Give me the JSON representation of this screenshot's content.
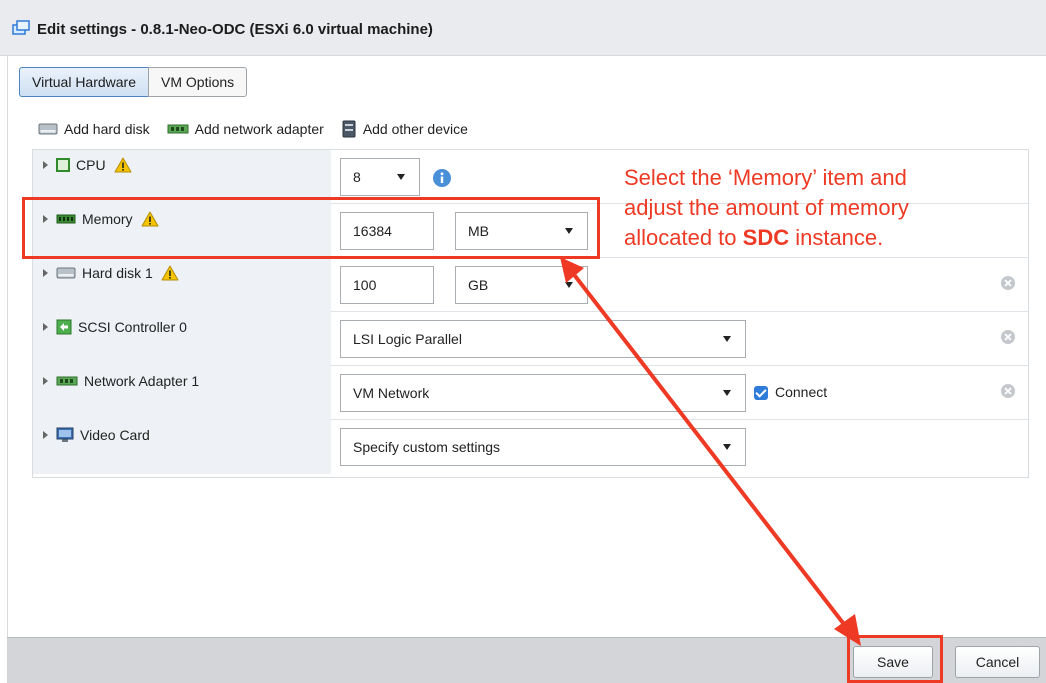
{
  "window": {
    "title": "Edit settings - 0.8.1-Neo-ODC (ESXi 6.0 virtual machine)",
    "icon": "vm-edit-icon"
  },
  "tabs": [
    {
      "label": "Virtual Hardware",
      "active": true
    },
    {
      "label": "VM Options",
      "active": false
    }
  ],
  "toolbar": {
    "add_hard_disk": "Add hard disk",
    "add_network_adapter": "Add network adapter",
    "add_other_device": "Add other device"
  },
  "hardware": {
    "cpu": {
      "label": "CPU",
      "value": "8",
      "warning": true
    },
    "memory": {
      "label": "Memory",
      "value": "16384",
      "unit": "MB",
      "warning": true
    },
    "hard_disk": {
      "label": "Hard disk 1",
      "value": "100",
      "unit": "GB",
      "warning": true
    },
    "scsi": {
      "label": "SCSI Controller 0",
      "value": "LSI Logic Parallel"
    },
    "network": {
      "label": "Network Adapter 1",
      "value": "VM Network",
      "connect_label": "Connect",
      "connected": true
    },
    "video": {
      "label": "Video Card",
      "value": "Specify custom settings"
    }
  },
  "footer": {
    "save_label": "Save",
    "cancel_label": "Cancel"
  },
  "annotation": {
    "line1": "Select the ‘Memory’ item and",
    "line2": "adjust the amount of memory",
    "line3_pre": "allocated to ",
    "line3_bold": "SDC",
    "line3_post": " instance.",
    "color": "#ee3a24"
  },
  "colors": {
    "accent": "#2f7bd9",
    "warning": "#f5c400",
    "annotation": "#ee3a24",
    "label_bg": "#eef2f6"
  }
}
